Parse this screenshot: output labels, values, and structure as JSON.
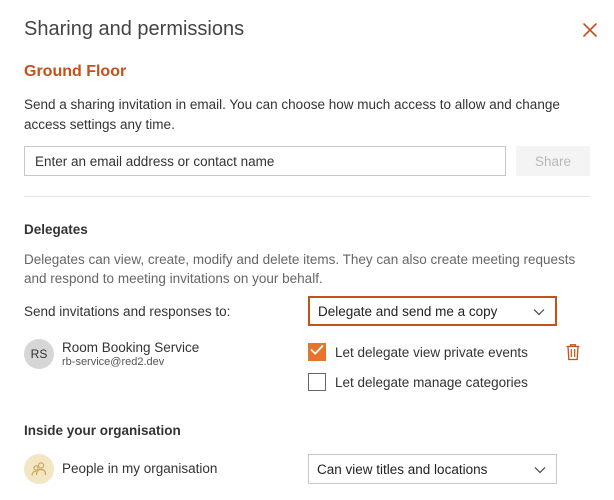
{
  "dialog": {
    "title": "Sharing and permissions",
    "calendar_name": "Ground Floor",
    "intro": "Send a sharing invitation in email. You can choose how much access to allow and change access settings any time.",
    "email_placeholder": "Enter an email address or contact name",
    "share_label": "Share"
  },
  "delegates": {
    "heading": "Delegates",
    "description": "Delegates can view, create, modify and delete items. They can also create meeting requests and respond to meeting invitations on your behalf.",
    "send_label": "Send invitations and responses to:",
    "send_value": "Delegate and send me a copy",
    "person": {
      "initials": "RS",
      "name": "Room Booking Service",
      "email": "rb-service@red2.dev"
    },
    "options": [
      {
        "label": "Let delegate view private events",
        "checked": true
      },
      {
        "label": "Let delegate manage categories",
        "checked": false
      }
    ]
  },
  "organisation": {
    "heading": "Inside your organisation",
    "label": "People in my organisation",
    "permission": "Can view titles and locations"
  },
  "colors": {
    "accent": "#c4501a",
    "checkbox": "#e6742d",
    "org_avatar_bg": "#f2e6c4"
  },
  "icons": [
    "close-icon",
    "chevron-down-icon",
    "checkmark-icon",
    "trash-icon",
    "people-icon"
  ]
}
